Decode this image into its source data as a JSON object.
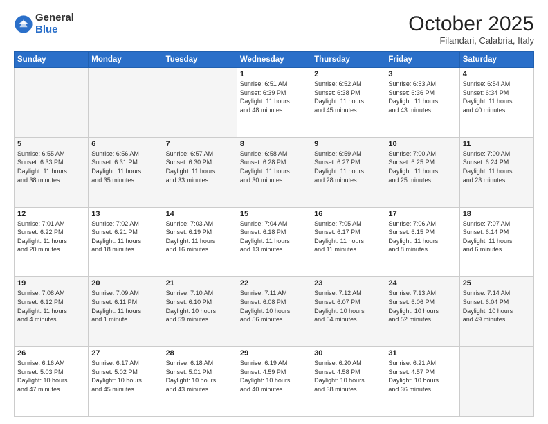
{
  "logo": {
    "general": "General",
    "blue": "Blue"
  },
  "title": "October 2025",
  "location": "Filandari, Calabria, Italy",
  "days_header": [
    "Sunday",
    "Monday",
    "Tuesday",
    "Wednesday",
    "Thursday",
    "Friday",
    "Saturday"
  ],
  "weeks": [
    [
      {
        "day": "",
        "detail": ""
      },
      {
        "day": "",
        "detail": ""
      },
      {
        "day": "",
        "detail": ""
      },
      {
        "day": "1",
        "detail": "Sunrise: 6:51 AM\nSunset: 6:39 PM\nDaylight: 11 hours\nand 48 minutes."
      },
      {
        "day": "2",
        "detail": "Sunrise: 6:52 AM\nSunset: 6:38 PM\nDaylight: 11 hours\nand 45 minutes."
      },
      {
        "day": "3",
        "detail": "Sunrise: 6:53 AM\nSunset: 6:36 PM\nDaylight: 11 hours\nand 43 minutes."
      },
      {
        "day": "4",
        "detail": "Sunrise: 6:54 AM\nSunset: 6:34 PM\nDaylight: 11 hours\nand 40 minutes."
      }
    ],
    [
      {
        "day": "5",
        "detail": "Sunrise: 6:55 AM\nSunset: 6:33 PM\nDaylight: 11 hours\nand 38 minutes."
      },
      {
        "day": "6",
        "detail": "Sunrise: 6:56 AM\nSunset: 6:31 PM\nDaylight: 11 hours\nand 35 minutes."
      },
      {
        "day": "7",
        "detail": "Sunrise: 6:57 AM\nSunset: 6:30 PM\nDaylight: 11 hours\nand 33 minutes."
      },
      {
        "day": "8",
        "detail": "Sunrise: 6:58 AM\nSunset: 6:28 PM\nDaylight: 11 hours\nand 30 minutes."
      },
      {
        "day": "9",
        "detail": "Sunrise: 6:59 AM\nSunset: 6:27 PM\nDaylight: 11 hours\nand 28 minutes."
      },
      {
        "day": "10",
        "detail": "Sunrise: 7:00 AM\nSunset: 6:25 PM\nDaylight: 11 hours\nand 25 minutes."
      },
      {
        "day": "11",
        "detail": "Sunrise: 7:00 AM\nSunset: 6:24 PM\nDaylight: 11 hours\nand 23 minutes."
      }
    ],
    [
      {
        "day": "12",
        "detail": "Sunrise: 7:01 AM\nSunset: 6:22 PM\nDaylight: 11 hours\nand 20 minutes."
      },
      {
        "day": "13",
        "detail": "Sunrise: 7:02 AM\nSunset: 6:21 PM\nDaylight: 11 hours\nand 18 minutes."
      },
      {
        "day": "14",
        "detail": "Sunrise: 7:03 AM\nSunset: 6:19 PM\nDaylight: 11 hours\nand 16 minutes."
      },
      {
        "day": "15",
        "detail": "Sunrise: 7:04 AM\nSunset: 6:18 PM\nDaylight: 11 hours\nand 13 minutes."
      },
      {
        "day": "16",
        "detail": "Sunrise: 7:05 AM\nSunset: 6:17 PM\nDaylight: 11 hours\nand 11 minutes."
      },
      {
        "day": "17",
        "detail": "Sunrise: 7:06 AM\nSunset: 6:15 PM\nDaylight: 11 hours\nand 8 minutes."
      },
      {
        "day": "18",
        "detail": "Sunrise: 7:07 AM\nSunset: 6:14 PM\nDaylight: 11 hours\nand 6 minutes."
      }
    ],
    [
      {
        "day": "19",
        "detail": "Sunrise: 7:08 AM\nSunset: 6:12 PM\nDaylight: 11 hours\nand 4 minutes."
      },
      {
        "day": "20",
        "detail": "Sunrise: 7:09 AM\nSunset: 6:11 PM\nDaylight: 11 hours\nand 1 minute."
      },
      {
        "day": "21",
        "detail": "Sunrise: 7:10 AM\nSunset: 6:10 PM\nDaylight: 10 hours\nand 59 minutes."
      },
      {
        "day": "22",
        "detail": "Sunrise: 7:11 AM\nSunset: 6:08 PM\nDaylight: 10 hours\nand 56 minutes."
      },
      {
        "day": "23",
        "detail": "Sunrise: 7:12 AM\nSunset: 6:07 PM\nDaylight: 10 hours\nand 54 minutes."
      },
      {
        "day": "24",
        "detail": "Sunrise: 7:13 AM\nSunset: 6:06 PM\nDaylight: 10 hours\nand 52 minutes."
      },
      {
        "day": "25",
        "detail": "Sunrise: 7:14 AM\nSunset: 6:04 PM\nDaylight: 10 hours\nand 49 minutes."
      }
    ],
    [
      {
        "day": "26",
        "detail": "Sunrise: 6:16 AM\nSunset: 5:03 PM\nDaylight: 10 hours\nand 47 minutes."
      },
      {
        "day": "27",
        "detail": "Sunrise: 6:17 AM\nSunset: 5:02 PM\nDaylight: 10 hours\nand 45 minutes."
      },
      {
        "day": "28",
        "detail": "Sunrise: 6:18 AM\nSunset: 5:01 PM\nDaylight: 10 hours\nand 43 minutes."
      },
      {
        "day": "29",
        "detail": "Sunrise: 6:19 AM\nSunset: 4:59 PM\nDaylight: 10 hours\nand 40 minutes."
      },
      {
        "day": "30",
        "detail": "Sunrise: 6:20 AM\nSunset: 4:58 PM\nDaylight: 10 hours\nand 38 minutes."
      },
      {
        "day": "31",
        "detail": "Sunrise: 6:21 AM\nSunset: 4:57 PM\nDaylight: 10 hours\nand 36 minutes."
      },
      {
        "day": "",
        "detail": ""
      }
    ]
  ]
}
